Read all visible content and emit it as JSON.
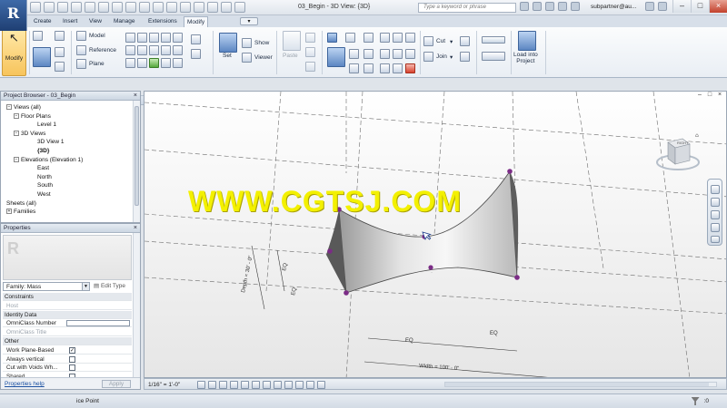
{
  "app": {
    "logo_letter": "R",
    "window_title": "03_Begin - 3D View: {3D}",
    "search_placeholder": "Type a keyword or phrase",
    "user": "subpartner@au..."
  },
  "tabs": [
    "Create",
    "Insert",
    "View",
    "Manage",
    "Extensions",
    "Modify"
  ],
  "active_tab": "Modify",
  "ribbon": {
    "modify_label": "Modify",
    "model_label": "Model",
    "reference_label": "Reference",
    "plane_label": "Plane",
    "set_label": "Set",
    "show_label": "Show",
    "viewer_label": "Viewer",
    "paste_label": "Paste",
    "cut_label": "Cut",
    "join_label": "Join",
    "load_into_project_label": "Load into\nProject"
  },
  "project_browser": {
    "title": "Project Browser - 03_Begin",
    "tree": [
      {
        "label": "Views (all)",
        "level": 0,
        "toggle": "−"
      },
      {
        "label": "Floor Plans",
        "level": 1,
        "toggle": "−"
      },
      {
        "label": "Level 1",
        "level": 2,
        "toggle": ""
      },
      {
        "label": "3D Views",
        "level": 1,
        "toggle": "−"
      },
      {
        "label": "3D View 1",
        "level": 2,
        "toggle": ""
      },
      {
        "label": "{3D}",
        "level": 2,
        "toggle": "",
        "bold": true
      },
      {
        "label": "Elevations (Elevation 1)",
        "level": 1,
        "toggle": "−"
      },
      {
        "label": "East",
        "level": 2,
        "toggle": ""
      },
      {
        "label": "North",
        "level": 2,
        "toggle": ""
      },
      {
        "label": "South",
        "level": 2,
        "toggle": ""
      },
      {
        "label": "West",
        "level": 2,
        "toggle": ""
      },
      {
        "label": "Sheets (all)",
        "level": 0,
        "toggle": ""
      },
      {
        "label": "Families",
        "level": 0,
        "toggle": "+"
      }
    ]
  },
  "properties": {
    "title": "Properties",
    "family_select": "Family: Mass",
    "edit_type": "Edit Type",
    "rows": [
      {
        "type": "group",
        "label": "Constraints"
      },
      {
        "type": "field",
        "label": "Host",
        "gray": true,
        "value": ""
      },
      {
        "type": "group",
        "label": "Identity Data"
      },
      {
        "type": "field",
        "label": "OmniClass Number",
        "input": true,
        "value": ""
      },
      {
        "type": "field",
        "label": "OmniClass Title",
        "gray": true,
        "value": ""
      },
      {
        "type": "group",
        "label": "Other"
      },
      {
        "type": "check",
        "label": "Work Plane-Based",
        "checked": true
      },
      {
        "type": "check",
        "label": "Always vertical",
        "checked": false
      },
      {
        "type": "check",
        "label": "Cut with Voids Wh...",
        "checked": false
      },
      {
        "type": "check",
        "label": "Shared",
        "checked": false
      }
    ],
    "help_link": "Properties help",
    "apply_label": "Apply"
  },
  "viewport": {
    "watermark": "WWW.CGTSJ.COM",
    "viewcube_face": "RIGHT",
    "dim_labels": {
      "depth": "Depth = 30' - 0\"",
      "width": "Width = 100' - 0\"",
      "eq": "EQ"
    }
  },
  "view_control_bar": {
    "scale": "1/16\" = 1'-0\""
  },
  "status_bar": {
    "text": "ice Point",
    "filter_count": ":0"
  },
  "colors": {
    "accent": "#f7c45c",
    "watermark": "#f3f000",
    "point": "#7b2c86"
  }
}
